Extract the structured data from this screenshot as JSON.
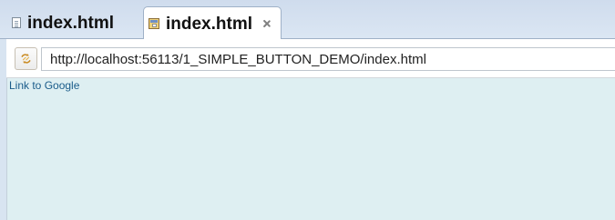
{
  "tabs": [
    {
      "label": "index.html",
      "icon": "file-icon",
      "active": false
    },
    {
      "label": "index.html",
      "icon": "browser-page-icon",
      "active": true,
      "close_icon": "close-icon"
    }
  ],
  "toolbar": {
    "refresh_icon": "refresh-icon",
    "url": "http://localhost:56113/1_SIMPLE_BUTTON_DEMO/index.html"
  },
  "page": {
    "link_text": "Link to Google"
  },
  "colors": {
    "tab_background": "#d8e4f1",
    "content_background": "#deeff2",
    "link": "#1a5c8a"
  }
}
